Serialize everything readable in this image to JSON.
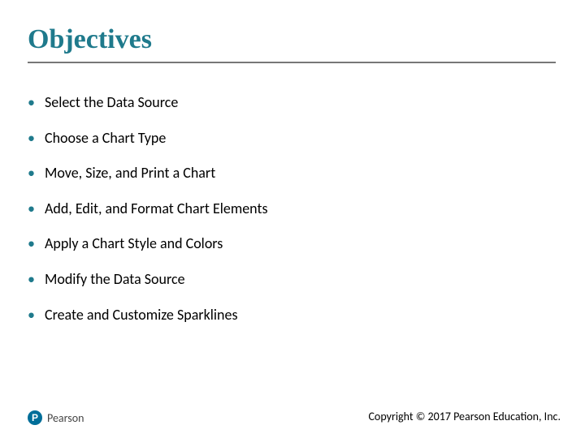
{
  "title": "Objectives",
  "bullets": [
    "Select the Data Source",
    "Choose a Chart Type",
    "Move, Size, and Print a Chart",
    "Add, Edit, and Format Chart Elements",
    "Apply a Chart Style and Colors",
    "Modify the Data Source",
    "Create and Customize Sparklines"
  ],
  "logo": {
    "badge": "P",
    "name": "Pearson"
  },
  "copyright": "Copyright © 2017 Pearson Education, Inc."
}
